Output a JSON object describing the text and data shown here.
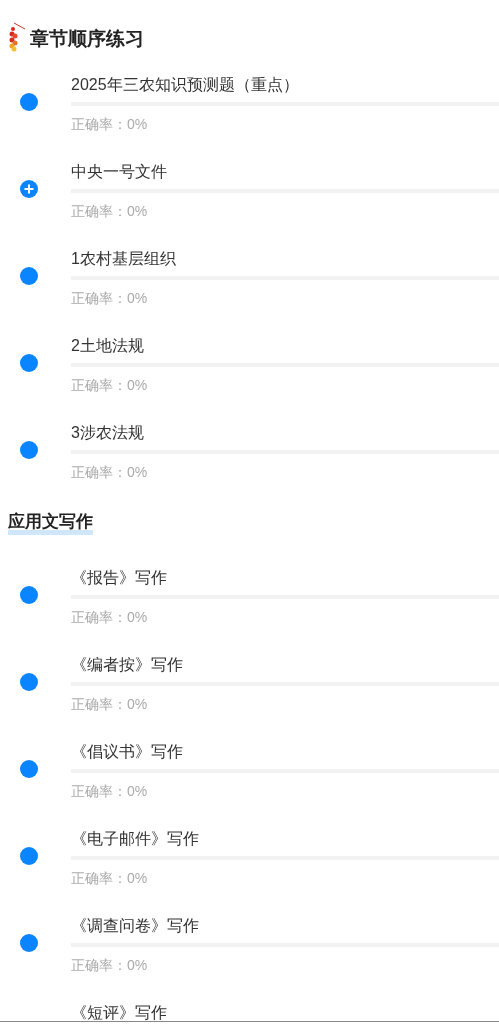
{
  "sections": [
    {
      "title": "章节顺序练习",
      "has_icon": true,
      "highlight": false,
      "items": [
        {
          "kind": "dot",
          "title": "2025年三农知识预测题（重点）",
          "level": 0,
          "accuracy": "正确率：0%"
        },
        {
          "kind": "plus",
          "title": "中央一号文件",
          "level": 0,
          "accuracy": "正确率：0%"
        },
        {
          "kind": "dot",
          "title": "1农村基层组织",
          "level": 0,
          "accuracy": "正确率：0%"
        },
        {
          "kind": "dot",
          "title": "2土地法规",
          "level": 0,
          "accuracy": "正确率：0%"
        },
        {
          "kind": "dot",
          "title": "3涉农法规",
          "level": 0,
          "accuracy": "正确率：0%"
        }
      ]
    },
    {
      "title": "应用文写作",
      "has_icon": false,
      "highlight": true,
      "items": [
        {
          "kind": "dot",
          "title": "《报告》写作",
          "level": 0,
          "accuracy": "正确率：0%"
        },
        {
          "kind": "dot",
          "title": "《编者按》写作",
          "level": 0,
          "accuracy": "正确率：0%"
        },
        {
          "kind": "dot",
          "title": "《倡议书》写作",
          "level": 0,
          "accuracy": "正确率：0%"
        },
        {
          "kind": "dot",
          "title": "《电子邮件》写作",
          "level": 0,
          "accuracy": "正确率：0%"
        },
        {
          "kind": "dot",
          "title": "《调查问卷》写作",
          "level": 0,
          "accuracy": "正确率：0%"
        },
        {
          "title": "《短评》写作"
        }
      ]
    }
  ]
}
